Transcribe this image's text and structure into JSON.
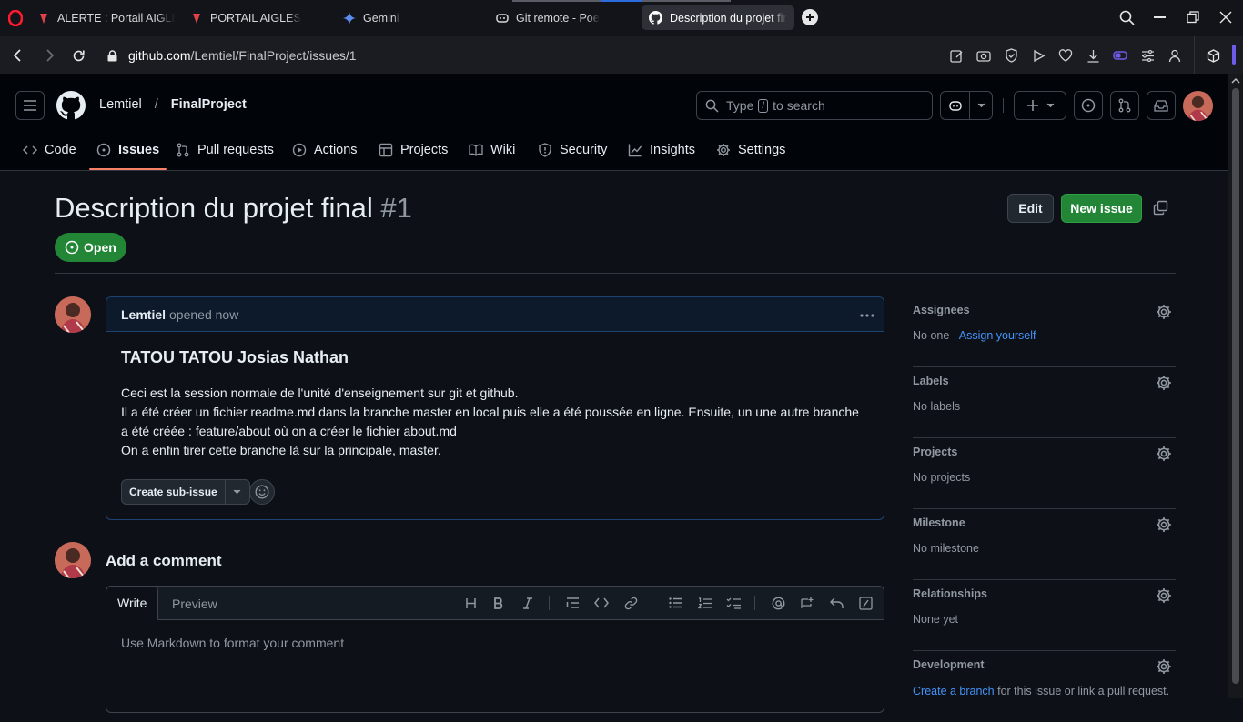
{
  "browser": {
    "tabs": [
      {
        "label": "ALERTE : Portail AIGLES cib",
        "icon": "aigles-favicon",
        "active": false
      },
      {
        "label": "PORTAIL AIGLES",
        "icon": "aigles-favicon",
        "active": false
      },
      {
        "label": "Gemini",
        "icon": "gemini-favicon",
        "active": false
      },
      {
        "label": "Git remote - Poe",
        "icon": "poe-favicon",
        "active": false
      },
      {
        "label": "Description du projet final",
        "icon": "github-favicon",
        "active": true
      }
    ],
    "url_host": "github.com",
    "url_path": "/Lemtiel/FinalProject/issues/1"
  },
  "header": {
    "owner": "Lemtiel",
    "separator": "/",
    "repo": "FinalProject",
    "search_prefix": "Type",
    "search_key": "/",
    "search_suffix": "to search"
  },
  "repo_tabs": [
    {
      "label": "Code",
      "icon": "code-icon"
    },
    {
      "label": "Issues",
      "icon": "issue-icon",
      "selected": true
    },
    {
      "label": "Pull requests",
      "icon": "pull-request-icon"
    },
    {
      "label": "Actions",
      "icon": "play-icon"
    },
    {
      "label": "Projects",
      "icon": "table-icon"
    },
    {
      "label": "Wiki",
      "icon": "book-icon"
    },
    {
      "label": "Security",
      "icon": "shield-icon"
    },
    {
      "label": "Insights",
      "icon": "graph-icon"
    },
    {
      "label": "Settings",
      "icon": "gear-icon"
    }
  ],
  "issue": {
    "title": "Description du projet final",
    "number": "#1",
    "state": "Open",
    "edit_label": "Edit",
    "new_issue_label": "New issue",
    "author": "Lemtiel",
    "opened_text": "opened now",
    "body_heading": "TATOU TATOU Josias Nathan",
    "body_lines": [
      "Ceci est la session normale de l'unité d'enseignement sur git et github.",
      "Il a été créer un fichier readme.md dans la branche master en local puis elle a été poussée en ligne. Ensuite, un une autre branche a été créée : feature/about où on a créer le fichier about.md",
      "On a enfin tirer cette branche là sur la principale, master."
    ],
    "create_subissue_label": "Create sub-issue"
  },
  "comment_form": {
    "heading": "Add a comment",
    "write_tab": "Write",
    "preview_tab": "Preview",
    "placeholder": "Use Markdown to format your comment"
  },
  "sidebar": {
    "assignees": {
      "label": "Assignees",
      "value": "No one -",
      "link": "Assign yourself"
    },
    "labels": {
      "label": "Labels",
      "value": "No labels"
    },
    "projects": {
      "label": "Projects",
      "value": "No projects"
    },
    "milestone": {
      "label": "Milestone",
      "value": "No milestone"
    },
    "relationships": {
      "label": "Relationships",
      "value": "None yet"
    },
    "development": {
      "label": "Development",
      "link": "Create a branch",
      "value": "for this issue or link a pull request."
    }
  },
  "colors": {
    "page_bg": "#0d1117",
    "header_bg": "#010409",
    "accent_green": "#238636",
    "link_blue": "#4493f8",
    "tab_underline": "#f78166"
  }
}
